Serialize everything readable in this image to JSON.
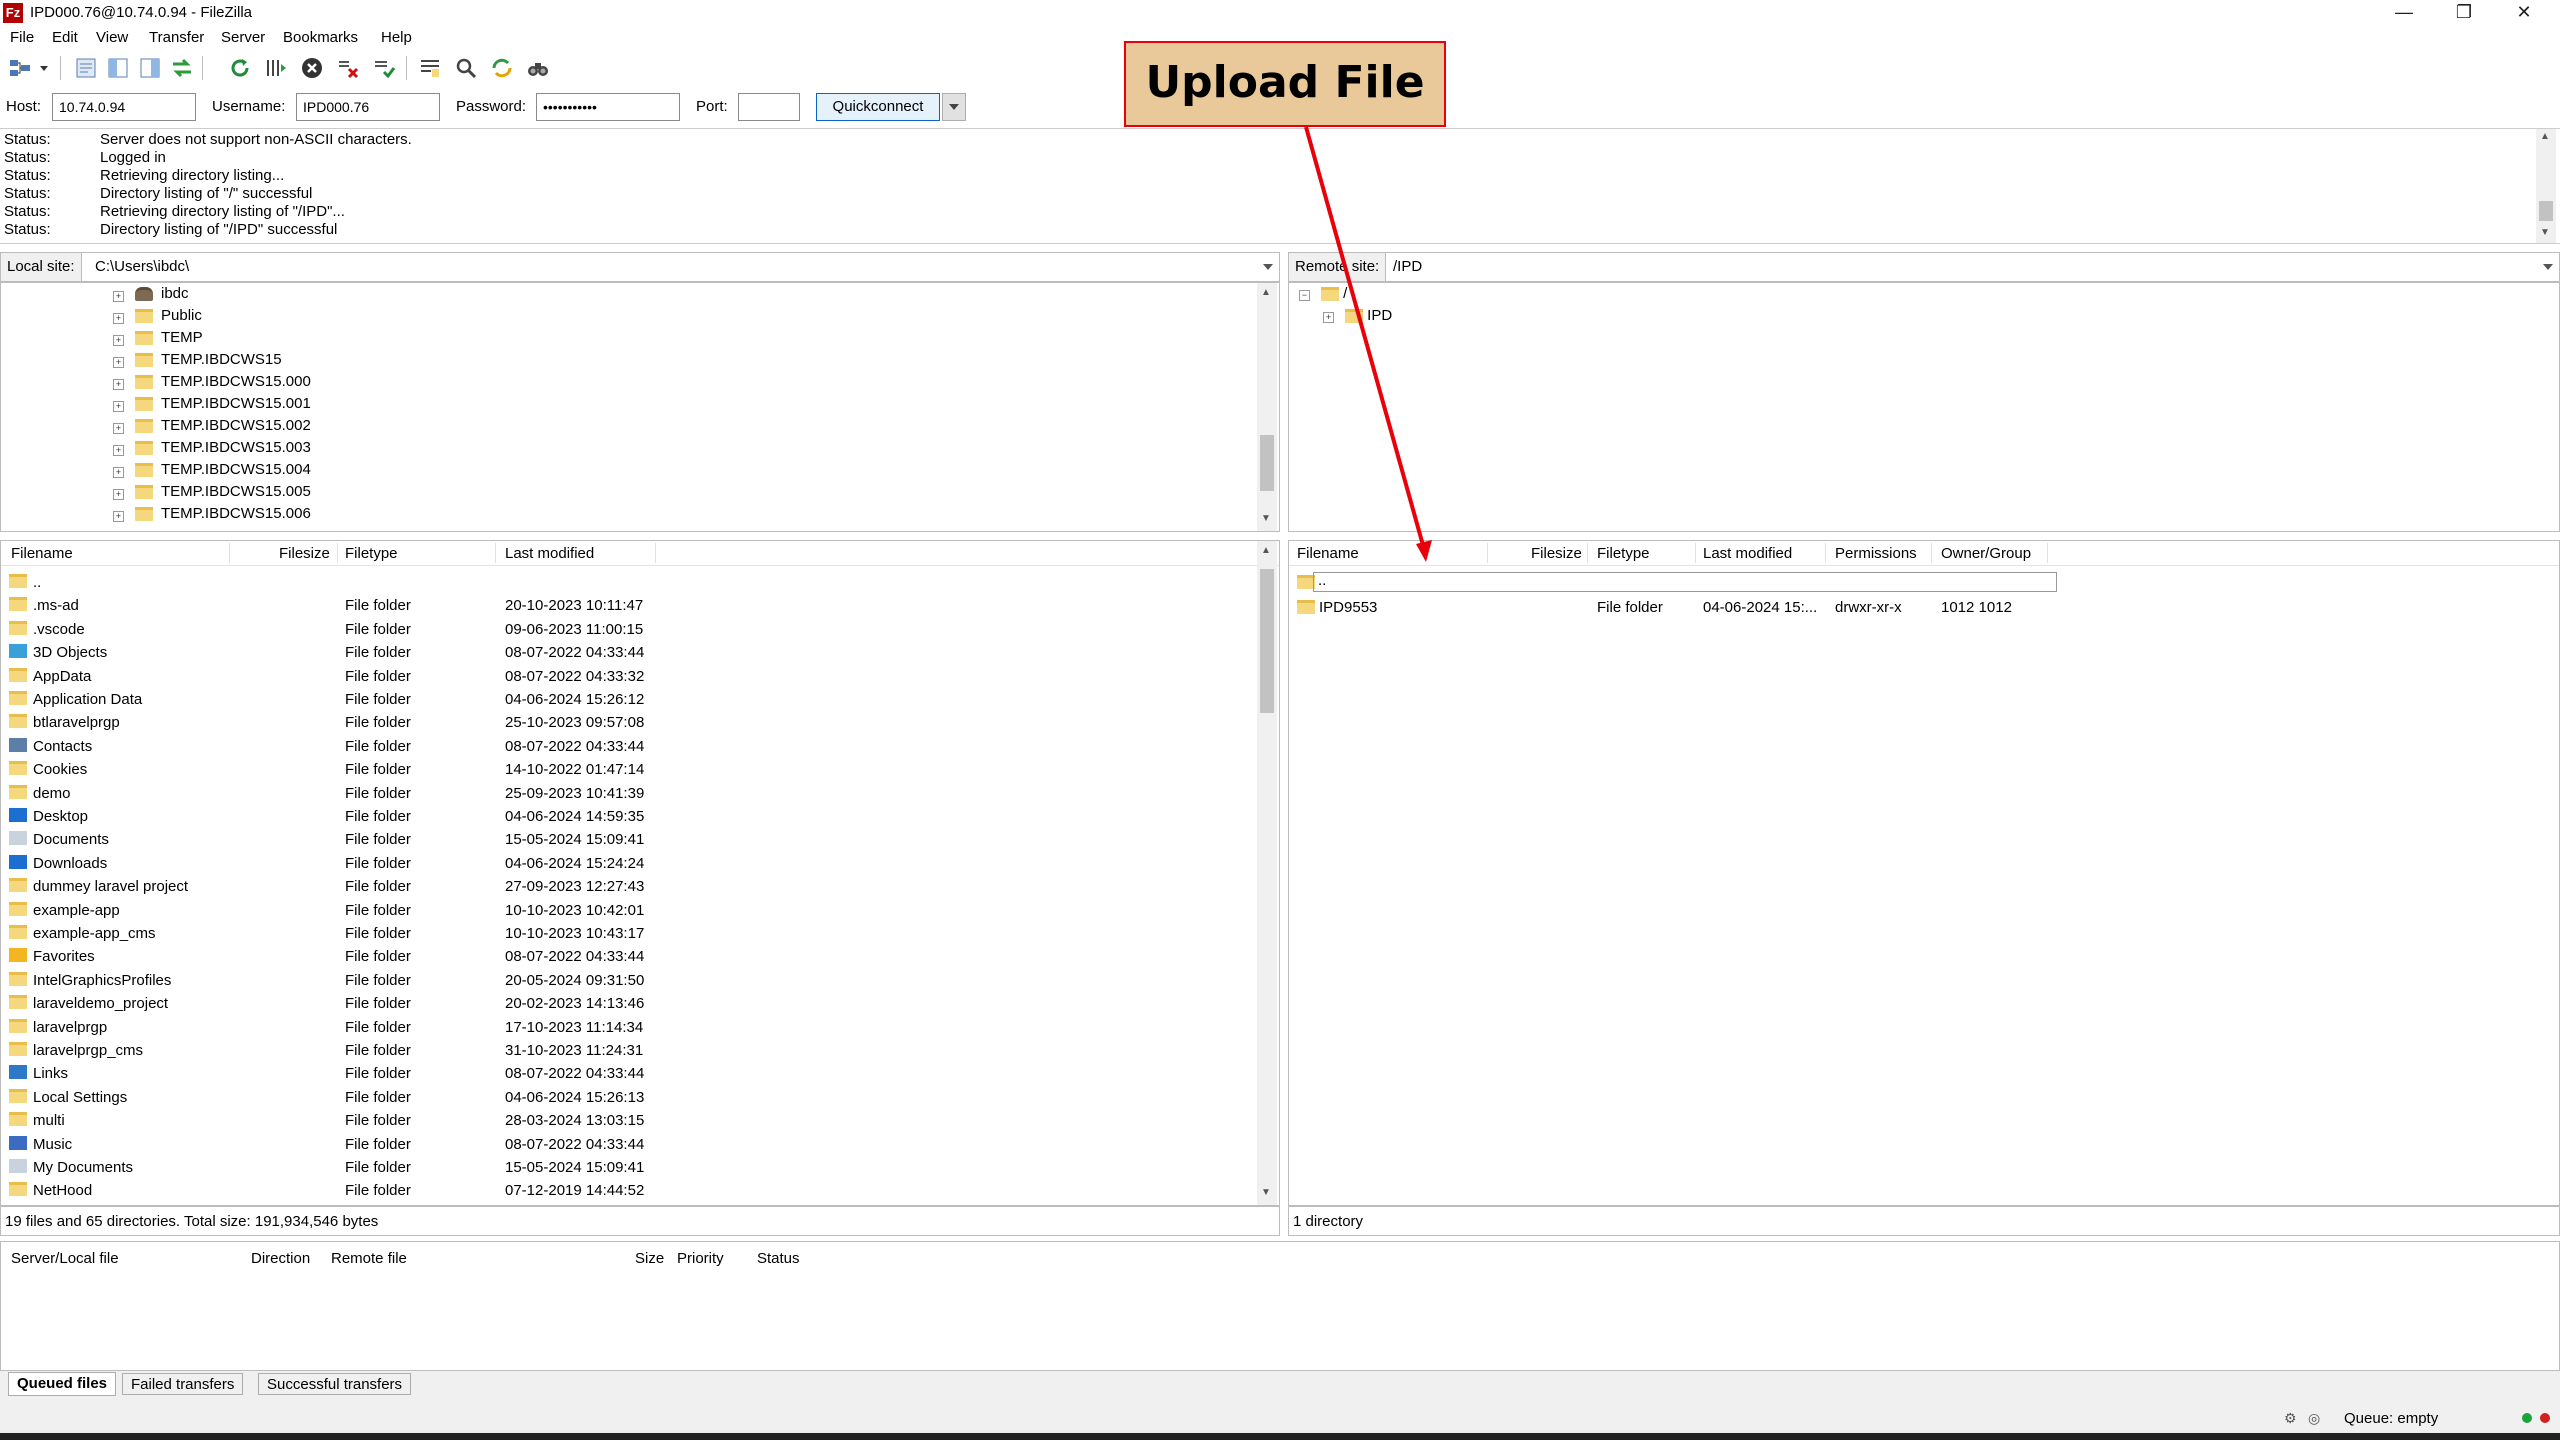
{
  "window": {
    "title": "IPD000.76@10.74.0.94 - FileZilla",
    "app_icon_text": "Fz"
  },
  "menu": [
    "File",
    "Edit",
    "View",
    "Transfer",
    "Server",
    "Bookmarks",
    "Help"
  ],
  "quickconnect": {
    "host_label": "Host:",
    "host_value": "10.74.0.94",
    "username_label": "Username:",
    "username_value": "IPD000.76",
    "password_label": "Password:",
    "password_value": "•••••••••••",
    "port_label": "Port:",
    "port_value": "",
    "button_label": "Quickconnect"
  },
  "log": [
    {
      "k": "Status:",
      "v": "Server does not support non-ASCII characters."
    },
    {
      "k": "Status:",
      "v": "Logged in"
    },
    {
      "k": "Status:",
      "v": "Retrieving directory listing..."
    },
    {
      "k": "Status:",
      "v": "Directory listing of \"/\" successful"
    },
    {
      "k": "Status:",
      "v": "Retrieving directory listing of \"/IPD\"..."
    },
    {
      "k": "Status:",
      "v": "Directory listing of \"/IPD\" successful"
    }
  ],
  "local": {
    "site_label": "Local site:",
    "path": "C:\\Users\\ibdc\\",
    "tree": [
      "ibdc",
      "Public",
      "TEMP",
      "TEMP.IBDCWS15",
      "TEMP.IBDCWS15.000",
      "TEMP.IBDCWS15.001",
      "TEMP.IBDCWS15.002",
      "TEMP.IBDCWS15.003",
      "TEMP.IBDCWS15.004",
      "TEMP.IBDCWS15.005",
      "TEMP.IBDCWS15.006"
    ],
    "headers": {
      "filename": "Filename",
      "filesize": "Filesize",
      "filetype": "Filetype",
      "modified": "Last modified"
    },
    "files": [
      {
        "name": "..",
        "type": "",
        "modified": "",
        "icon": "folder"
      },
      {
        "name": ".ms-ad",
        "type": "File folder",
        "modified": "20-10-2023 10:11:47",
        "icon": "folder"
      },
      {
        "name": ".vscode",
        "type": "File folder",
        "modified": "09-06-2023 11:00:15",
        "icon": "folder"
      },
      {
        "name": "3D Objects",
        "type": "File folder",
        "modified": "08-07-2022 04:33:44",
        "icon": "cube"
      },
      {
        "name": "AppData",
        "type": "File folder",
        "modified": "08-07-2022 04:33:32",
        "icon": "folder"
      },
      {
        "name": "Application Data",
        "type": "File folder",
        "modified": "04-06-2024 15:26:12",
        "icon": "folder"
      },
      {
        "name": "btlaravelprgp",
        "type": "File folder",
        "modified": "25-10-2023 09:57:08",
        "icon": "folder"
      },
      {
        "name": "Contacts",
        "type": "File folder",
        "modified": "08-07-2022 04:33:44",
        "icon": "contacts"
      },
      {
        "name": "Cookies",
        "type": "File folder",
        "modified": "14-10-2022 01:47:14",
        "icon": "folder"
      },
      {
        "name": "demo",
        "type": "File folder",
        "modified": "25-09-2023 10:41:39",
        "icon": "folder"
      },
      {
        "name": "Desktop",
        "type": "File folder",
        "modified": "04-06-2024 14:59:35",
        "icon": "desktop"
      },
      {
        "name": "Documents",
        "type": "File folder",
        "modified": "15-05-2024 15:09:41",
        "icon": "document"
      },
      {
        "name": "Downloads",
        "type": "File folder",
        "modified": "04-06-2024 15:24:24",
        "icon": "download"
      },
      {
        "name": "dummey laravel project",
        "type": "File folder",
        "modified": "27-09-2023 12:27:43",
        "icon": "folder"
      },
      {
        "name": "example-app",
        "type": "File folder",
        "modified": "10-10-2023 10:42:01",
        "icon": "folder"
      },
      {
        "name": "example-app_cms",
        "type": "File folder",
        "modified": "10-10-2023 10:43:17",
        "icon": "folder"
      },
      {
        "name": "Favorites",
        "type": "File folder",
        "modified": "08-07-2022 04:33:44",
        "icon": "star"
      },
      {
        "name": "IntelGraphicsProfiles",
        "type": "File folder",
        "modified": "20-05-2024 09:31:50",
        "icon": "folder"
      },
      {
        "name": "laraveldemo_project",
        "type": "File folder",
        "modified": "20-02-2023 14:13:46",
        "icon": "folder"
      },
      {
        "name": "laravelprgp",
        "type": "File folder",
        "modified": "17-10-2023 11:14:34",
        "icon": "folder"
      },
      {
        "name": "laravelprgp_cms",
        "type": "File folder",
        "modified": "31-10-2023 11:24:31",
        "icon": "folder"
      },
      {
        "name": "Links",
        "type": "File folder",
        "modified": "08-07-2022 04:33:44",
        "icon": "link"
      },
      {
        "name": "Local Settings",
        "type": "File folder",
        "modified": "04-06-2024 15:26:13",
        "icon": "folder"
      },
      {
        "name": "multi",
        "type": "File folder",
        "modified": "28-03-2024 13:03:15",
        "icon": "folder"
      },
      {
        "name": "Music",
        "type": "File folder",
        "modified": "08-07-2022 04:33:44",
        "icon": "music"
      },
      {
        "name": "My Documents",
        "type": "File folder",
        "modified": "15-05-2024 15:09:41",
        "icon": "document"
      },
      {
        "name": "NetHood",
        "type": "File folder",
        "modified": "07-12-2019 14:44:52",
        "icon": "folder"
      }
    ],
    "status": "19 files and 65 directories. Total size: 191,934,546 bytes"
  },
  "remote": {
    "site_label": "Remote site:",
    "path": "/IPD",
    "tree": [
      "/",
      "IPD"
    ],
    "headers": {
      "filename": "Filename",
      "filesize": "Filesize",
      "filetype": "Filetype",
      "modified": "Last modified",
      "permissions": "Permissions",
      "owner": "Owner/Group"
    },
    "files": [
      {
        "name": "..",
        "type": "",
        "modified": "",
        "permissions": "",
        "owner": ""
      },
      {
        "name": "IPD9553",
        "type": "File folder",
        "modified": "04-06-2024 15:...",
        "permissions": "drwxr-xr-x",
        "owner": "1012 1012"
      }
    ],
    "status": "1 directory"
  },
  "queue": {
    "headers": {
      "server_local": "Server/Local file",
      "direction": "Direction",
      "remote": "Remote file",
      "size": "Size",
      "priority": "Priority",
      "status": "Status"
    },
    "tabs": [
      "Queued files",
      "Failed transfers",
      "Successful transfers"
    ],
    "queue_status": "Queue: empty"
  },
  "annotation": {
    "label": "Upload File",
    "color": "#e8000b"
  },
  "colors": {
    "folder": "#f5d77e",
    "accent": "#0a64c8"
  }
}
